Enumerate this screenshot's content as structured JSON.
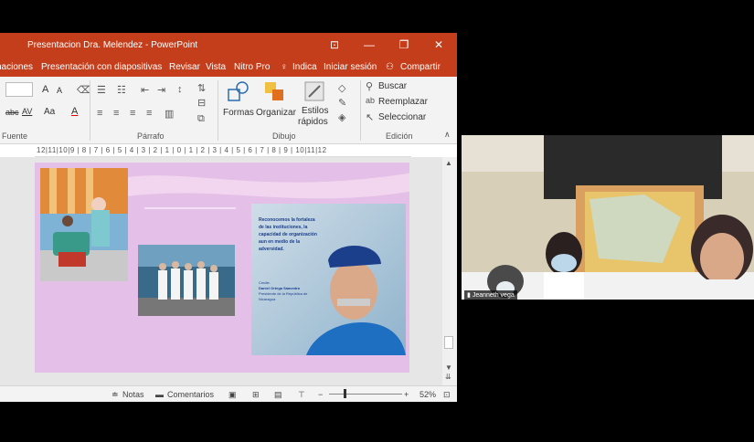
{
  "window": {
    "title": "Presentacion Dra. Melendez - PowerPoint",
    "controls": [
      "⊡",
      "—",
      "❐",
      "✕"
    ]
  },
  "menu": {
    "items": [
      "naciones",
      "Presentación con diapositivas",
      "Revisar",
      "Vista",
      "Nitro Pro",
      "Indica",
      "Iniciar sesión",
      "Compartir"
    ]
  },
  "ribbon": {
    "groups": {
      "fuente": "Fuente",
      "parrafo": "Párrafo",
      "dibujo": "Dibujo",
      "edicion": "Edición"
    },
    "dibujo": {
      "formas": "Formas",
      "organizar": "Organizar",
      "estilos": "Estilos",
      "rapidos": "rápidos"
    },
    "edicion": {
      "buscar": "Buscar",
      "reemplazar": "Reemplazar",
      "seleccionar": "Seleccionar"
    },
    "fuente": {
      "abc": "abc",
      "av": "AV",
      "aa": "Aa",
      "a1": "A",
      "a2": "A"
    }
  },
  "ruler": {
    "text": "12|11|10|9 | 8 | 7 | 6 | 5 | 4 | 3 | 2 | 1 | 0 | 1 | 2 | 3 | 4 | 5 | 6 | 7 | 8 | 9 | 10|11|12"
  },
  "slide": {
    "poster": {
      "quote": "Reconocemos la fortaleza de las instituciones, la capacidad de organización aun en medio de la adversidad.",
      "caption_prefix": "Cmdte.",
      "caption_name": "Daniel Ortega Saavedra",
      "caption_role": "Presidente de la República de Nicaragua"
    }
  },
  "statusbar": {
    "notas": "Notas",
    "comentarios": "Comentarios",
    "zoom": "52%"
  },
  "video": {
    "participant_name": "Jeanneth vega"
  },
  "colors": {
    "ppt_accent": "#c43e1c",
    "slide_bg": "#e4bfe8"
  }
}
